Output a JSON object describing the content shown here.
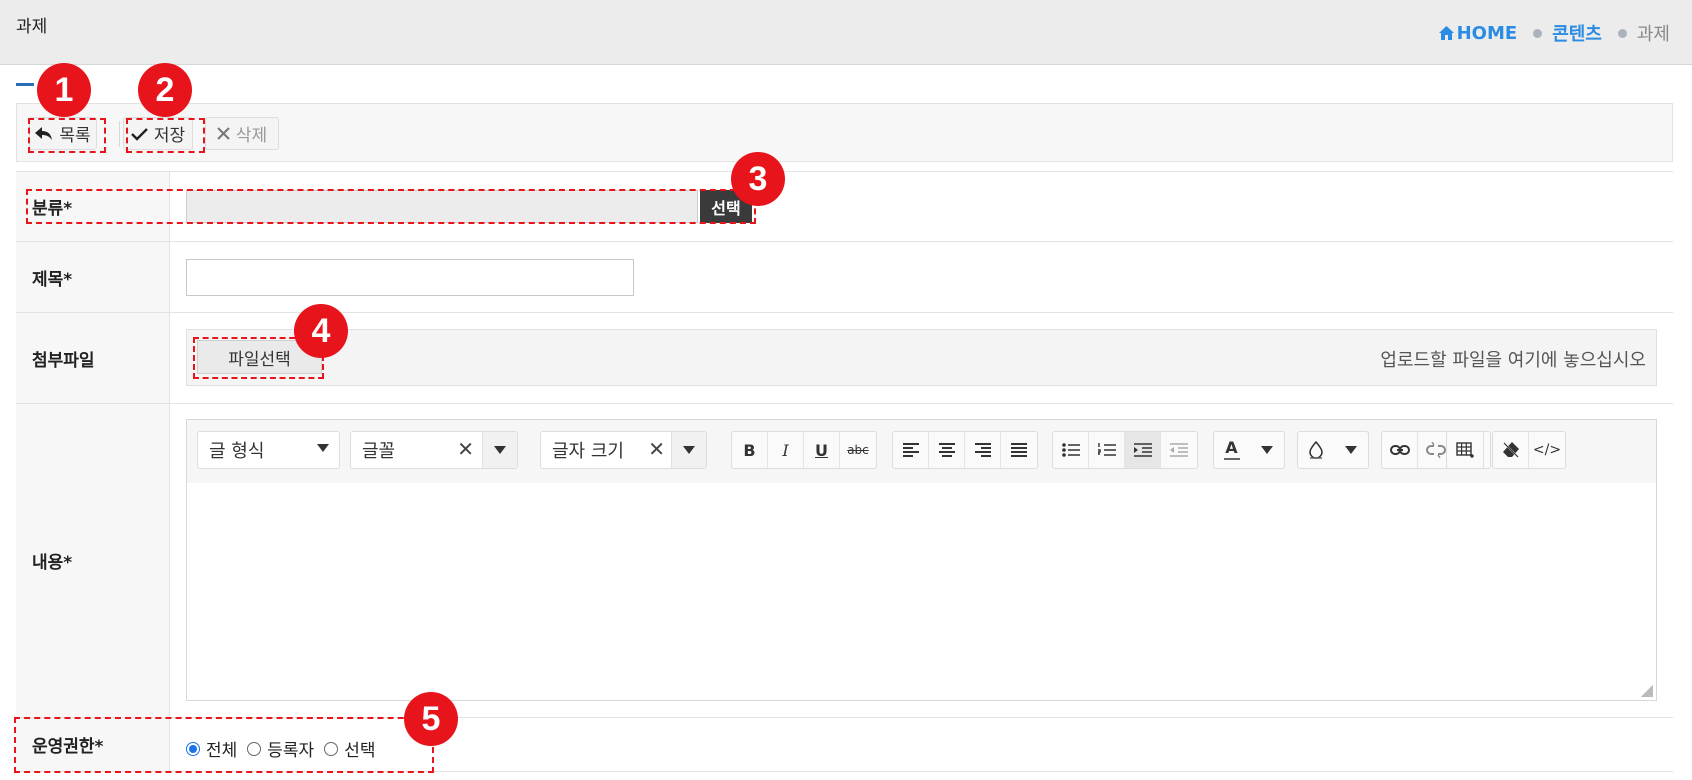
{
  "header": {
    "title": "과제",
    "breadcrumb": {
      "home": "HOME",
      "section": "콘텐츠",
      "current": "과제"
    }
  },
  "toolbar": {
    "list_label": "목록",
    "save_label": "저장",
    "delete_label": "삭제"
  },
  "form": {
    "category": {
      "label": "분류*",
      "value": "",
      "select_label": "선택"
    },
    "title": {
      "label": "제목*",
      "value": ""
    },
    "attachment": {
      "label": "첨부파일",
      "file_button": "파일선택",
      "drop_hint": "업로드할 파일을 여기에 놓으십시오"
    },
    "content": {
      "label": "내용*",
      "editor": {
        "format_select": "글 형식",
        "font_select": "글꼴",
        "size_select": "글자 크기",
        "buttons": {
          "bold": "B",
          "italic": "I",
          "underline": "U",
          "strikethrough": "abc",
          "align_left": "align-left-icon",
          "align_center": "align-center-icon",
          "align_right": "align-right-icon",
          "align_justify": "align-justify-icon",
          "bullet_list": "bullet-list-icon",
          "numbered_list": "numbered-list-icon",
          "indent": "indent-icon",
          "outdent": "outdent-icon",
          "text_color": "A",
          "bg_color": "fill-drop-icon",
          "link": "link-icon",
          "unlink": "unlink-icon",
          "image": "image-icon",
          "table": "table-icon",
          "clear_format": "eraser-icon",
          "source": "</>"
        },
        "body": ""
      }
    },
    "permission": {
      "label": "운영권한*",
      "options": [
        "전체",
        "등록자",
        "선택"
      ],
      "selected": "전체"
    }
  },
  "callouts": [
    "1",
    "2",
    "3",
    "4",
    "5"
  ],
  "colors": {
    "accent": "#2a8ce3",
    "callout": "#e8141c"
  }
}
